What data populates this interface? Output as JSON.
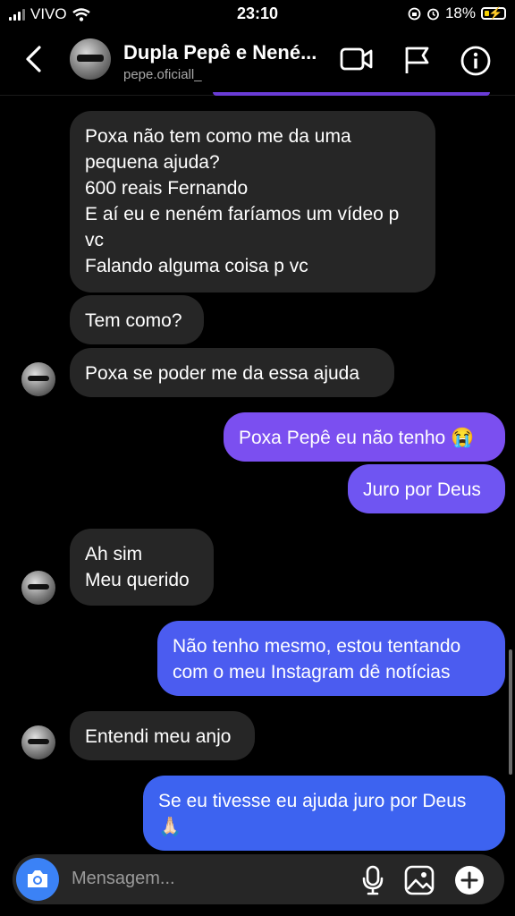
{
  "status_bar": {
    "carrier": "VIVO",
    "time": "23:10",
    "battery_percent": "18%",
    "battery_level": 0.18
  },
  "header": {
    "title": "Dupla Pepê e Nené...",
    "username": "pepe.oficiall_"
  },
  "messages": [
    {
      "id": "m1",
      "side": "in",
      "text": "Poxa não tem como me da uma\npequena ajuda?\n600 reais Fernando\nE aí eu e neném faríamos um vídeo p\nvc\nFalando alguma coisa p vc"
    },
    {
      "id": "m2",
      "side": "in",
      "text": "Tem como?"
    },
    {
      "id": "m3",
      "side": "in",
      "text": "Poxa se poder  me da essa ajuda"
    },
    {
      "id": "m4",
      "side": "out",
      "text": "Poxa Pepê eu não tenho 😭"
    },
    {
      "id": "m5",
      "side": "out",
      "text": "Juro por Deus"
    },
    {
      "id": "m6",
      "side": "in",
      "text": "Ah sim\nMeu querido"
    },
    {
      "id": "m7",
      "side": "out",
      "text": "Não tenho mesmo, estou tentando\ncom o meu Instagram dê notícias"
    },
    {
      "id": "m8",
      "side": "in",
      "text": "Entendi meu anjo"
    },
    {
      "id": "m9",
      "side": "out",
      "text": "Se eu tivesse eu ajuda juro por Deus\n🙏🏻"
    }
  ],
  "composer": {
    "placeholder": "Mensagem..."
  },
  "colors": {
    "incoming_bubble": "#262626",
    "outgoing_purple": "#7b4ff0",
    "outgoing_blue": "#3d63f0",
    "accent_blue": "#3b82f6"
  }
}
